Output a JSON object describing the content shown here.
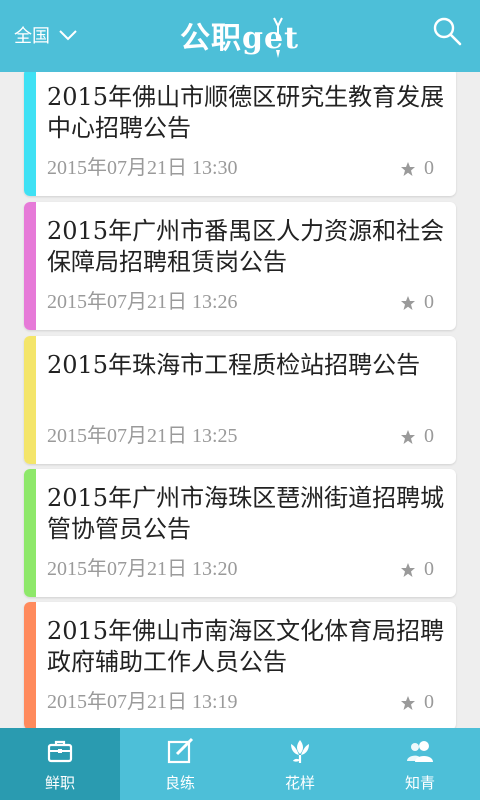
{
  "header": {
    "region_label": "全国",
    "logo_text": "公职get"
  },
  "colors": {
    "header_bg": "#4dbfd8",
    "tab_active_bg": "#2a9bb0",
    "stripes": [
      "#3fe1f4",
      "#e67ad8",
      "#f4e56a",
      "#8ee86a",
      "#ff8a5c"
    ]
  },
  "list": {
    "items": [
      {
        "title": "2015年佛山市顺德区研究生教育发展中心招聘公告",
        "date": "2015年07月21日 13:30",
        "favorites": "0"
      },
      {
        "title": "2015年广州市番禺区人力资源和社会保障局招聘租赁岗公告",
        "date": "2015年07月21日 13:26",
        "favorites": "0"
      },
      {
        "title": "2015年珠海市工程质检站招聘公告",
        "date": "2015年07月21日 13:25",
        "favorites": "0"
      },
      {
        "title": "2015年广州市海珠区琶洲街道招聘城管协管员公告",
        "date": "2015年07月21日 13:20",
        "favorites": "0"
      },
      {
        "title": "2015年佛山市南海区文化体育局招聘政府辅助工作人员公告",
        "date": "2015年07月21日 13:19",
        "favorites": "0"
      }
    ]
  },
  "tabbar": {
    "tabs": [
      {
        "label": "鲜职",
        "icon": "briefcase-icon",
        "active": true
      },
      {
        "label": "良练",
        "icon": "edit-icon",
        "active": false
      },
      {
        "label": "花样",
        "icon": "lotus-icon",
        "active": false
      },
      {
        "label": "知青",
        "icon": "people-icon",
        "active": false
      }
    ]
  }
}
